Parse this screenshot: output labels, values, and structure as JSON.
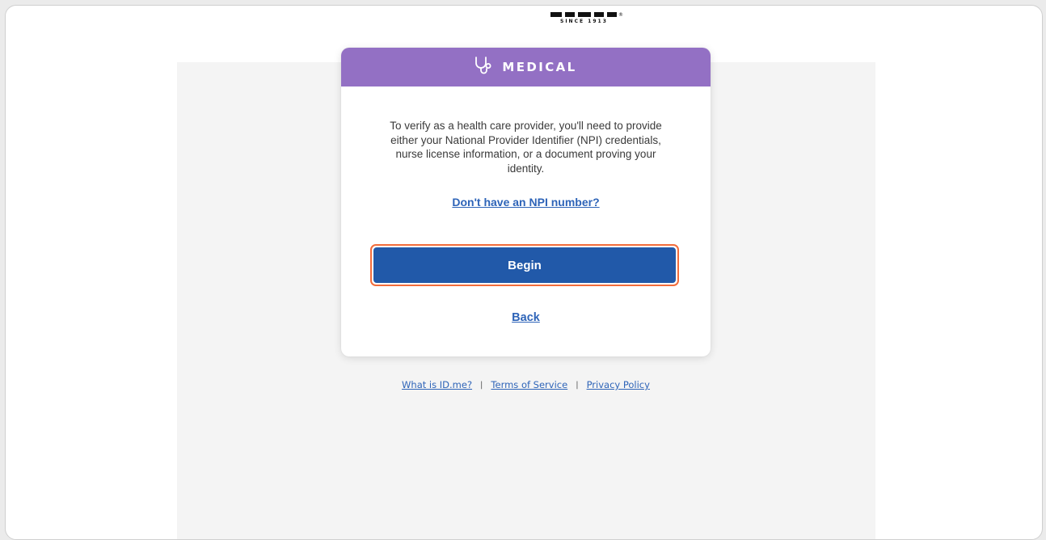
{
  "logo": {
    "since_text": "SINCE 1913"
  },
  "card": {
    "header_title": "MEDICAL",
    "header_icon": "stethoscope-icon",
    "header_color": "#9370c4",
    "description": "To verify as a health care provider, you'll need to provide either your National Provider Identifier (NPI) credentials, nurse license information, or a document proving your identity.",
    "npi_link": "Don't have an NPI number?",
    "begin_label": "Begin",
    "back_label": "Back"
  },
  "footer": {
    "what_is": "What is ID.me?",
    "separator": "|",
    "terms": "Terms of Service",
    "privacy": "Privacy Policy"
  },
  "colors": {
    "primary_button": "#2159a9",
    "focus_ring": "#f26c3b",
    "link": "#2e64b8"
  }
}
